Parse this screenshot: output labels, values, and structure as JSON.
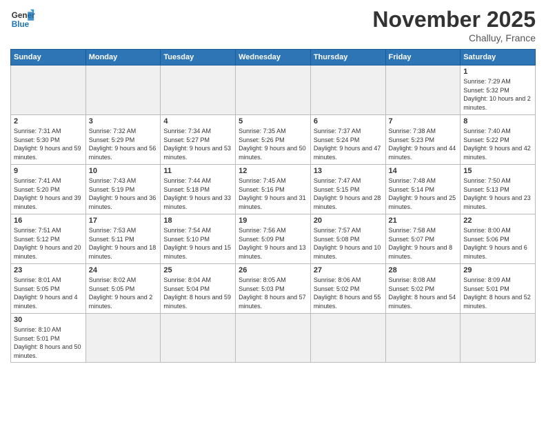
{
  "logo": {
    "general": "General",
    "blue": "Blue"
  },
  "header": {
    "month": "November 2025",
    "location": "Challuy, France"
  },
  "days_of_week": [
    "Sunday",
    "Monday",
    "Tuesday",
    "Wednesday",
    "Thursday",
    "Friday",
    "Saturday"
  ],
  "weeks": [
    [
      {
        "day": "",
        "info": "",
        "empty": true
      },
      {
        "day": "",
        "info": "",
        "empty": true
      },
      {
        "day": "",
        "info": "",
        "empty": true
      },
      {
        "day": "",
        "info": "",
        "empty": true
      },
      {
        "day": "",
        "info": "",
        "empty": true
      },
      {
        "day": "",
        "info": "",
        "empty": true
      },
      {
        "day": "1",
        "info": "Sunrise: 7:29 AM\nSunset: 5:32 PM\nDaylight: 10 hours\nand 2 minutes."
      }
    ],
    [
      {
        "day": "2",
        "info": "Sunrise: 7:31 AM\nSunset: 5:30 PM\nDaylight: 9 hours\nand 59 minutes."
      },
      {
        "day": "3",
        "info": "Sunrise: 7:32 AM\nSunset: 5:29 PM\nDaylight: 9 hours\nand 56 minutes."
      },
      {
        "day": "4",
        "info": "Sunrise: 7:34 AM\nSunset: 5:27 PM\nDaylight: 9 hours\nand 53 minutes."
      },
      {
        "day": "5",
        "info": "Sunrise: 7:35 AM\nSunset: 5:26 PM\nDaylight: 9 hours\nand 50 minutes."
      },
      {
        "day": "6",
        "info": "Sunrise: 7:37 AM\nSunset: 5:24 PM\nDaylight: 9 hours\nand 47 minutes."
      },
      {
        "day": "7",
        "info": "Sunrise: 7:38 AM\nSunset: 5:23 PM\nDaylight: 9 hours\nand 44 minutes."
      },
      {
        "day": "8",
        "info": "Sunrise: 7:40 AM\nSunset: 5:22 PM\nDaylight: 9 hours\nand 42 minutes."
      }
    ],
    [
      {
        "day": "9",
        "info": "Sunrise: 7:41 AM\nSunset: 5:20 PM\nDaylight: 9 hours\nand 39 minutes."
      },
      {
        "day": "10",
        "info": "Sunrise: 7:43 AM\nSunset: 5:19 PM\nDaylight: 9 hours\nand 36 minutes."
      },
      {
        "day": "11",
        "info": "Sunrise: 7:44 AM\nSunset: 5:18 PM\nDaylight: 9 hours\nand 33 minutes."
      },
      {
        "day": "12",
        "info": "Sunrise: 7:45 AM\nSunset: 5:16 PM\nDaylight: 9 hours\nand 31 minutes."
      },
      {
        "day": "13",
        "info": "Sunrise: 7:47 AM\nSunset: 5:15 PM\nDaylight: 9 hours\nand 28 minutes."
      },
      {
        "day": "14",
        "info": "Sunrise: 7:48 AM\nSunset: 5:14 PM\nDaylight: 9 hours\nand 25 minutes."
      },
      {
        "day": "15",
        "info": "Sunrise: 7:50 AM\nSunset: 5:13 PM\nDaylight: 9 hours\nand 23 minutes."
      }
    ],
    [
      {
        "day": "16",
        "info": "Sunrise: 7:51 AM\nSunset: 5:12 PM\nDaylight: 9 hours\nand 20 minutes."
      },
      {
        "day": "17",
        "info": "Sunrise: 7:53 AM\nSunset: 5:11 PM\nDaylight: 9 hours\nand 18 minutes."
      },
      {
        "day": "18",
        "info": "Sunrise: 7:54 AM\nSunset: 5:10 PM\nDaylight: 9 hours\nand 15 minutes."
      },
      {
        "day": "19",
        "info": "Sunrise: 7:56 AM\nSunset: 5:09 PM\nDaylight: 9 hours\nand 13 minutes."
      },
      {
        "day": "20",
        "info": "Sunrise: 7:57 AM\nSunset: 5:08 PM\nDaylight: 9 hours\nand 10 minutes."
      },
      {
        "day": "21",
        "info": "Sunrise: 7:58 AM\nSunset: 5:07 PM\nDaylight: 9 hours\nand 8 minutes."
      },
      {
        "day": "22",
        "info": "Sunrise: 8:00 AM\nSunset: 5:06 PM\nDaylight: 9 hours\nand 6 minutes."
      }
    ],
    [
      {
        "day": "23",
        "info": "Sunrise: 8:01 AM\nSunset: 5:05 PM\nDaylight: 9 hours\nand 4 minutes."
      },
      {
        "day": "24",
        "info": "Sunrise: 8:02 AM\nSunset: 5:05 PM\nDaylight: 9 hours\nand 2 minutes."
      },
      {
        "day": "25",
        "info": "Sunrise: 8:04 AM\nSunset: 5:04 PM\nDaylight: 8 hours\nand 59 minutes."
      },
      {
        "day": "26",
        "info": "Sunrise: 8:05 AM\nSunset: 5:03 PM\nDaylight: 8 hours\nand 57 minutes."
      },
      {
        "day": "27",
        "info": "Sunrise: 8:06 AM\nSunset: 5:02 PM\nDaylight: 8 hours\nand 55 minutes."
      },
      {
        "day": "28",
        "info": "Sunrise: 8:08 AM\nSunset: 5:02 PM\nDaylight: 8 hours\nand 54 minutes."
      },
      {
        "day": "29",
        "info": "Sunrise: 8:09 AM\nSunset: 5:01 PM\nDaylight: 8 hours\nand 52 minutes."
      }
    ],
    [
      {
        "day": "30",
        "info": "Sunrise: 8:10 AM\nSunset: 5:01 PM\nDaylight: 8 hours\nand 50 minutes."
      },
      {
        "day": "",
        "info": "",
        "empty": true
      },
      {
        "day": "",
        "info": "",
        "empty": true
      },
      {
        "day": "",
        "info": "",
        "empty": true
      },
      {
        "day": "",
        "info": "",
        "empty": true
      },
      {
        "day": "",
        "info": "",
        "empty": true
      },
      {
        "day": "",
        "info": "",
        "empty": true
      }
    ]
  ]
}
